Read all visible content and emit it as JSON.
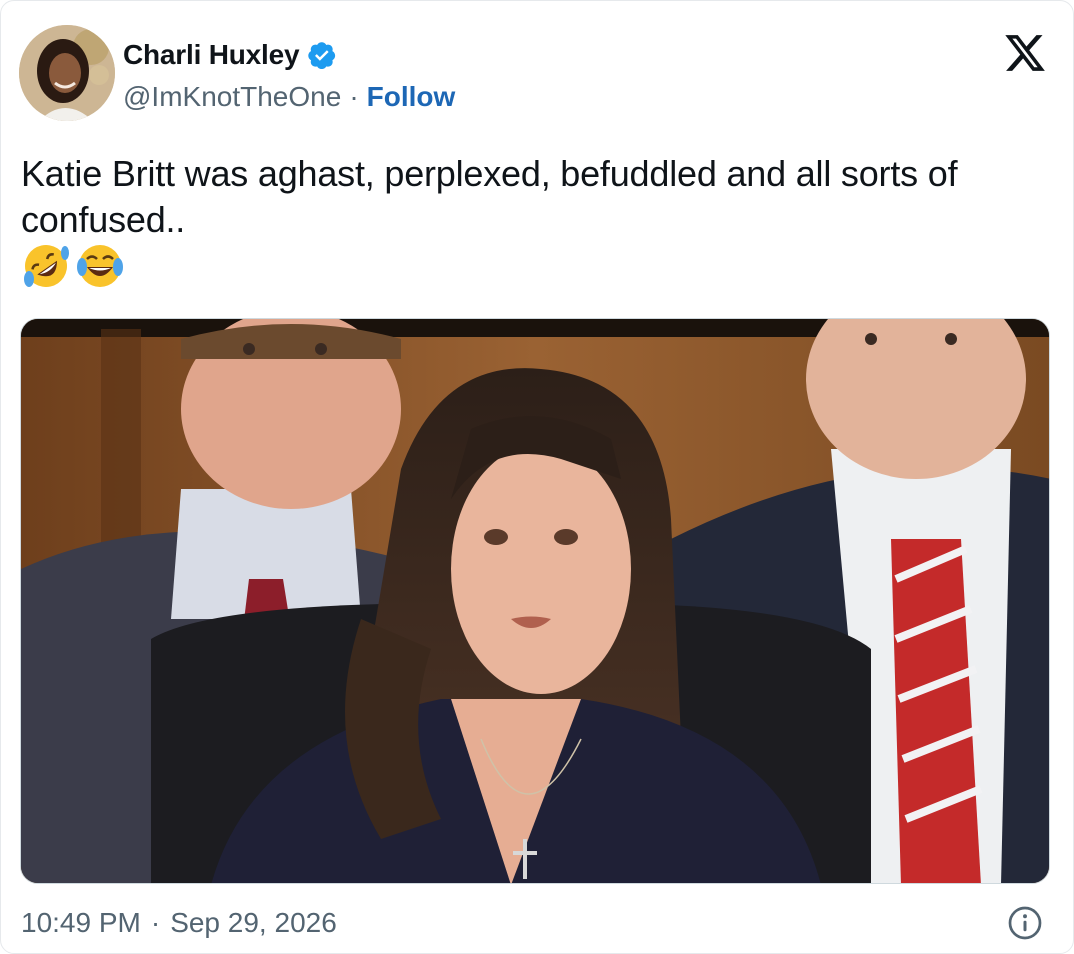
{
  "author": {
    "display_name": "Charli Huxley",
    "handle": "@ImKnotTheOne",
    "separator": "·",
    "follow_label": "Follow",
    "verified": true,
    "avatar_icon": "avatar-photo"
  },
  "tweet": {
    "text": "Katie Britt was aghast, perplexed, befuddled and all sorts of confused..",
    "emojis": [
      "rolling-on-floor-laughing",
      "face-with-tears-of-joy"
    ]
  },
  "media": {
    "type": "photo"
  },
  "footer": {
    "time": "10:49 PM",
    "separator": "·",
    "date": "Sep 29, 2026",
    "info_icon": "info-icon"
  },
  "colors": {
    "accent": "#1d67b5",
    "verified_badge": "#1d9bf0",
    "muted_text": "#536471",
    "text": "#0f1419"
  }
}
